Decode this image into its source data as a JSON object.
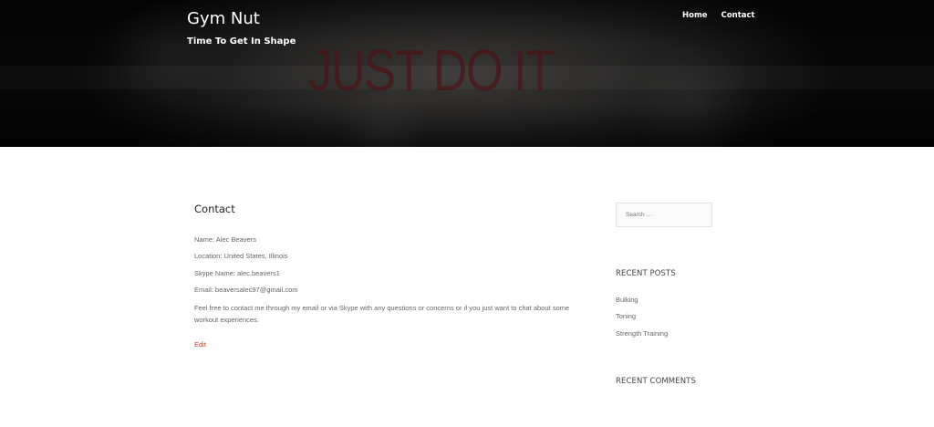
{
  "header": {
    "site_title": "Gym Nut",
    "tagline": "Time To Get In Shape",
    "hero_text": "JUST DO IT",
    "nav": [
      {
        "label": "Home"
      },
      {
        "label": "Contact"
      }
    ]
  },
  "main": {
    "page_title": "Contact",
    "lines": [
      "Name: Alec Beavers",
      "Location: United States, Illinois",
      "Skype Name: alec.beavers1",
      "Email: beaversalec97@gmail.com"
    ],
    "message": "Feel free to contact me through my email or via Skype with any questions or concerns or if you just want to chat about some workout experiences.",
    "edit_label": "Edit"
  },
  "sidebar": {
    "search_placeholder": "Search …",
    "recent_posts_title": "RECENT POSTS",
    "recent_posts": [
      {
        "label": "Bulking"
      },
      {
        "label": "Toning"
      },
      {
        "label": "Strength Training"
      }
    ],
    "recent_comments_title": "RECENT COMMENTS"
  },
  "colors": {
    "accent": "#c0392b",
    "hero_text": "#4a1518"
  }
}
